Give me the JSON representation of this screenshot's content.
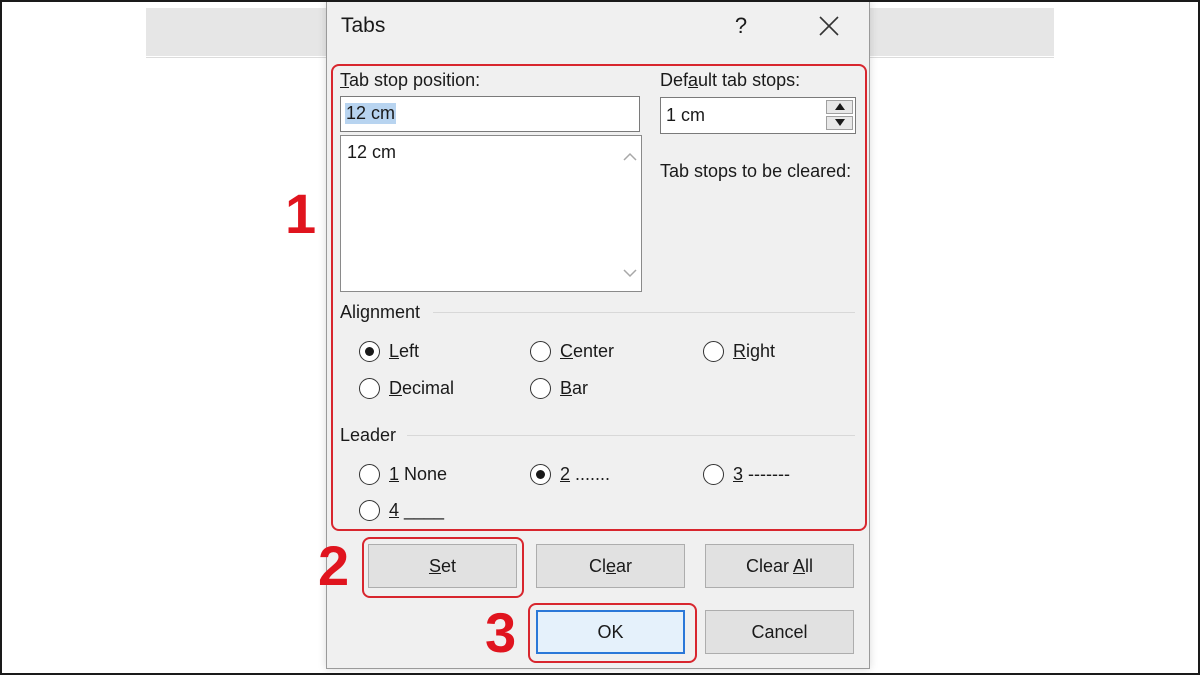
{
  "dialog": {
    "title": "Tabs",
    "help_label": "?",
    "tab_stop_position": {
      "label_pre": "",
      "label_acc": "T",
      "label_post": "ab stop position:",
      "value": "12 cm",
      "list_items": [
        "12 cm"
      ]
    },
    "default_tab_stops": {
      "label_pre": "Def",
      "label_acc": "a",
      "label_post": "ult tab stops:",
      "value": "1 cm"
    },
    "tab_stops_to_be_cleared": {
      "label": "Tab stops to be cleared:"
    },
    "alignment": {
      "label": "Alignment",
      "options": [
        {
          "acc": "L",
          "rest": "eft",
          "selected": true
        },
        {
          "acc": "C",
          "rest": "enter",
          "selected": false
        },
        {
          "acc": "R",
          "rest": "ight",
          "selected": false
        },
        {
          "acc": "D",
          "rest": "ecimal",
          "selected": false
        },
        {
          "acc": "B",
          "rest": "ar",
          "selected": false
        }
      ]
    },
    "leader": {
      "label": "Leader",
      "options": [
        {
          "acc": "1",
          "rest": " None",
          "selected": false
        },
        {
          "acc": "2",
          "rest": " .......",
          "selected": true
        },
        {
          "acc": "3",
          "rest": " -------",
          "selected": false
        },
        {
          "acc": "4",
          "rest": " ____",
          "selected": false
        }
      ]
    },
    "buttons": {
      "set": {
        "pre": "",
        "acc": "S",
        "post": "et"
      },
      "clear": {
        "pre": "Cl",
        "acc": "e",
        "post": "ar"
      },
      "clear_all": {
        "pre": "Clear ",
        "acc": "A",
        "post": "ll"
      },
      "ok": {
        "label": "OK"
      },
      "cancel": {
        "label": "Cancel"
      }
    }
  },
  "annotations": {
    "step1": "1",
    "step2": "2",
    "step3": "3",
    "color": "#e0141e"
  }
}
